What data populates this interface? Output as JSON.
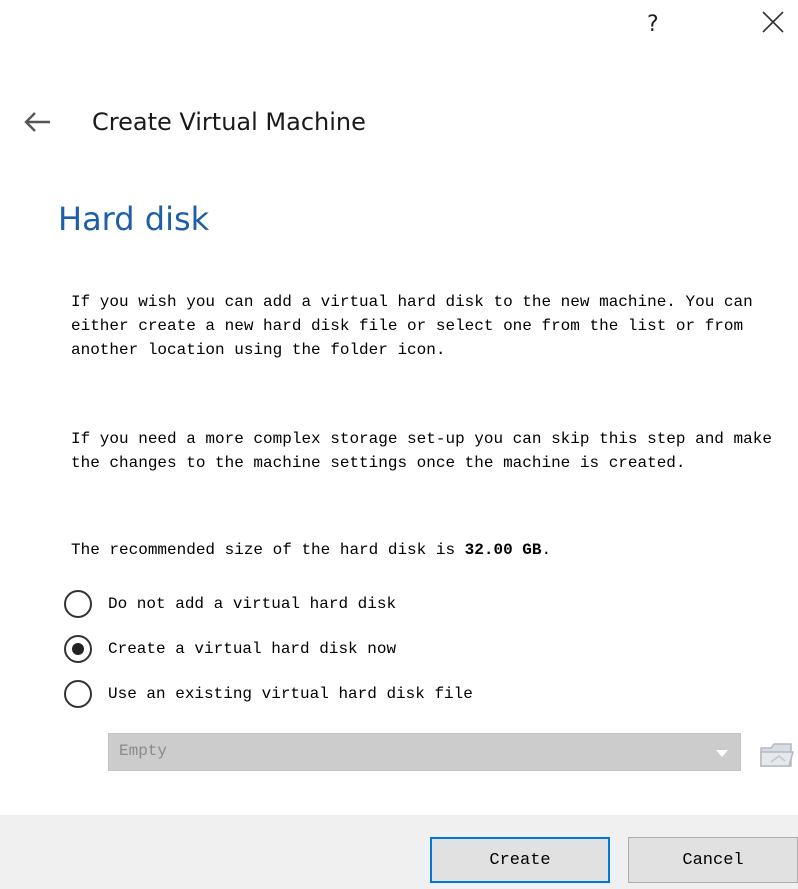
{
  "window": {
    "help_label": "?",
    "close_icon": "close-icon"
  },
  "header": {
    "back_icon": "back-arrow-icon",
    "title": "Create Virtual Machine"
  },
  "page": {
    "title": "Hard disk",
    "paragraph1": "If you wish you can add a virtual hard disk to the new machine. You can either create a new hard disk file or select one from the list or from another location using the folder icon.",
    "paragraph2": "If you need a more complex storage set-up you can skip this step and make the changes to the machine settings once the machine is created.",
    "recommended_prefix": "The recommended size of the hard disk is ",
    "recommended_size": "32.00 GB",
    "recommended_suffix": "."
  },
  "options": [
    {
      "label": "Do not add a virtual hard disk",
      "selected": false
    },
    {
      "label": "Create a virtual hard disk now",
      "selected": true
    },
    {
      "label": "Use an existing virtual hard disk file",
      "selected": false
    }
  ],
  "disk_select": {
    "value": "Empty",
    "enabled": false,
    "folder_icon": "folder-icon"
  },
  "buttons": {
    "create_label": "Create",
    "cancel_label": "Cancel"
  },
  "colors": {
    "title_accent": "#1f5fa8",
    "default_button_border": "#0078d7",
    "footer_background": "#f0f0f0",
    "disabled_select_background": "#cccccc"
  }
}
